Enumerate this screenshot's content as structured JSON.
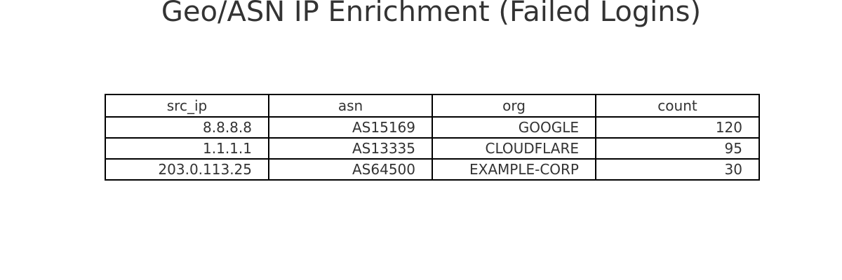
{
  "chart_data": {
    "type": "table",
    "title": "Geo/ASN IP Enrichment (Failed Logins)",
    "columns": [
      "src_ip",
      "asn",
      "org",
      "count"
    ],
    "rows": [
      [
        "8.8.8.8",
        "AS15169",
        "GOOGLE",
        "120"
      ],
      [
        "1.1.1.1",
        "AS13335",
        "CLOUDFLARE",
        "95"
      ],
      [
        "203.0.113.25",
        "AS64500",
        "EXAMPLE-CORP",
        "30"
      ]
    ]
  }
}
